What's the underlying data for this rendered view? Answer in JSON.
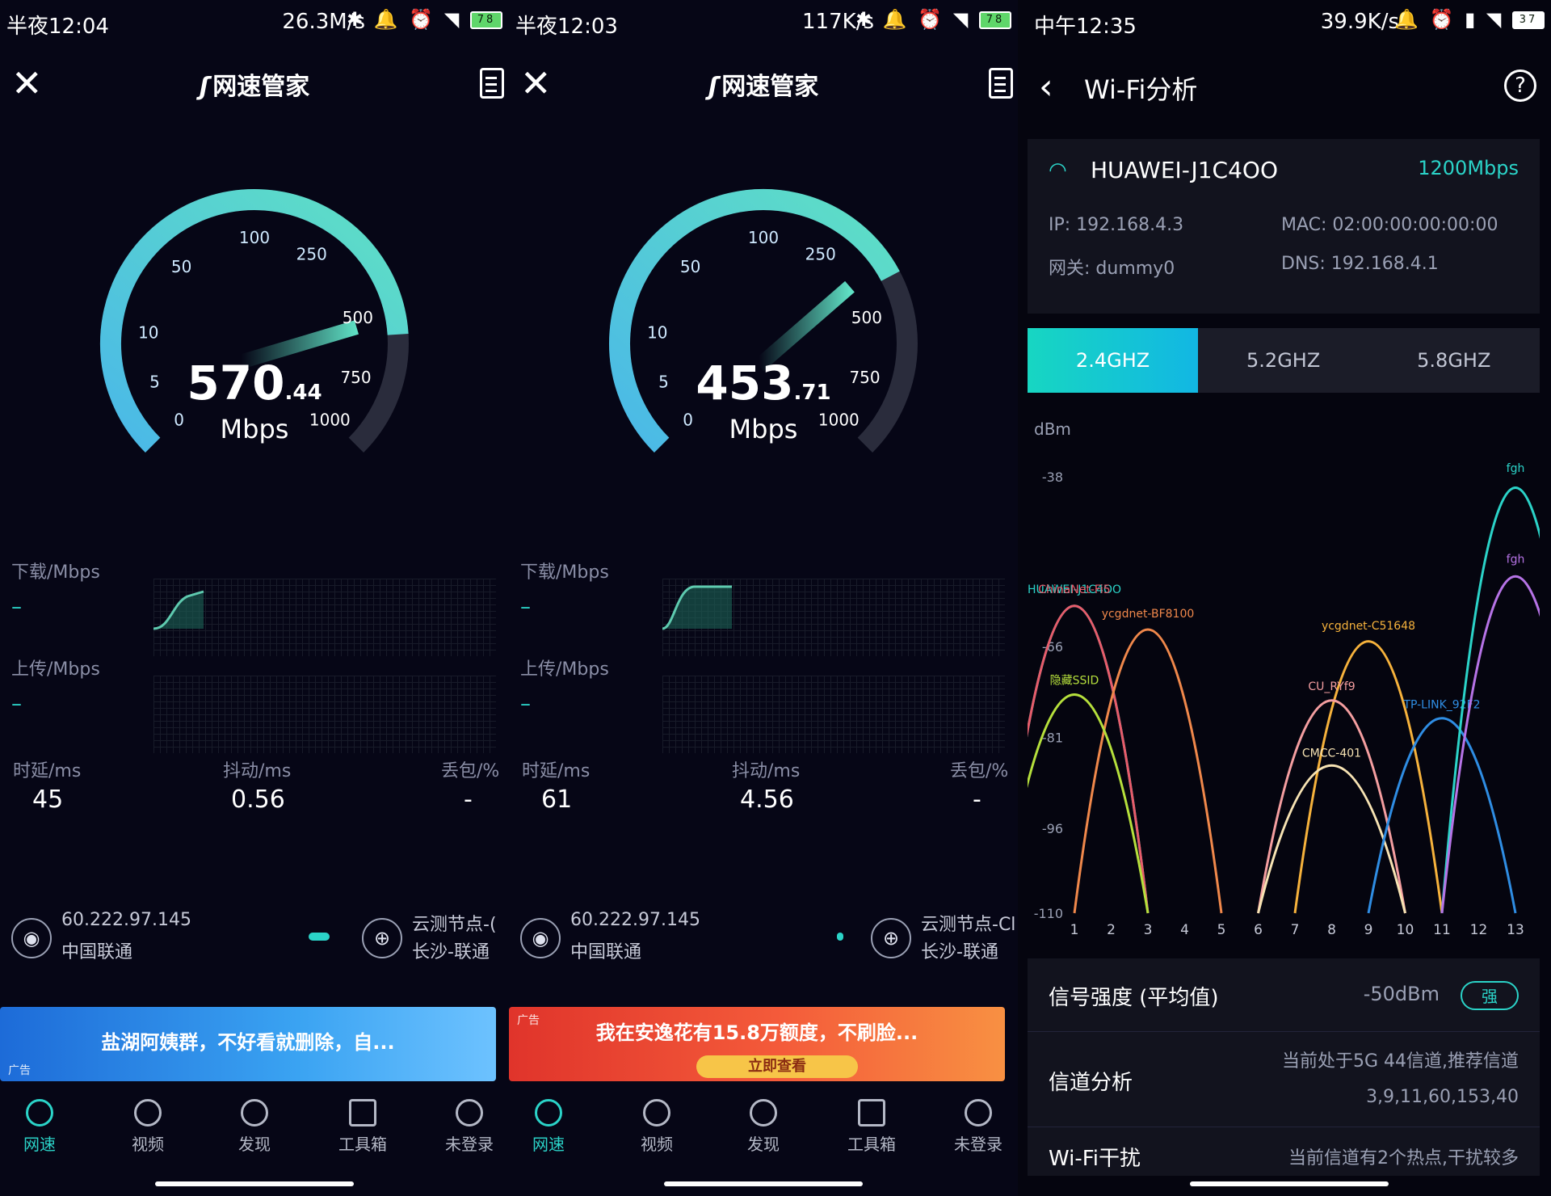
{
  "colors": {
    "accent": "#2bd3c8",
    "bg": "#060616"
  },
  "panels": [
    {
      "status": {
        "time": "半夜12:04",
        "speed": "26.3M/s",
        "battery": "78"
      },
      "brand": "网速管家",
      "gauge": {
        "ticks": [
          "0",
          "5",
          "10",
          "50",
          "100",
          "250",
          "500",
          "750",
          "1000"
        ],
        "value_fraction": 0.82
      },
      "reading": {
        "main": "570",
        "decimal": ".44",
        "unit": "Mbps"
      },
      "download_label": "下载/Mbps",
      "download_value": "–",
      "upload_label": "上传/Mbps",
      "upload_value": "–",
      "latency_label": "时延/ms",
      "latency": "45",
      "jitter_label": "抖动/ms",
      "jitter": "0.56",
      "loss_label": "丢包/%",
      "loss": "-",
      "ip": "60.222.97.145",
      "isp": "中国联通",
      "node": "云测节点-(",
      "node_isp": "长沙-联通",
      "ad": {
        "text": "盐湖阿姨群，不好看就删除，自...",
        "tag": "广告"
      }
    },
    {
      "status": {
        "time": "半夜12:03",
        "speed": "117K/s",
        "battery": "78"
      },
      "brand": "网速管家",
      "gauge": {
        "ticks": [
          "0",
          "5",
          "10",
          "50",
          "100",
          "250",
          "500",
          "750",
          "1000"
        ],
        "value_fraction": 0.73
      },
      "reading": {
        "main": "453",
        "decimal": ".71",
        "unit": "Mbps"
      },
      "download_label": "下载/Mbps",
      "download_value": "–",
      "upload_label": "上传/Mbps",
      "upload_value": "–",
      "latency_label": "时延/ms",
      "latency": "61",
      "jitter_label": "抖动/ms",
      "jitter": "4.56",
      "loss_label": "丢包/%",
      "loss": "-",
      "ip": "60.222.97.145",
      "isp": "中国联通",
      "node": "云测节点-Cl",
      "node_isp": "长沙-联通",
      "ad": {
        "text": "我在安逸花有15.8万额度，不刷脸...",
        "tag": "广告",
        "button": "立即查看"
      }
    }
  ],
  "tabs": [
    "网速",
    "视频",
    "发现",
    "工具箱",
    "未登录"
  ],
  "wifi": {
    "status": {
      "time": "中午12:35",
      "speed": "39.9K/s",
      "battery": "37"
    },
    "title": "Wi-Fi分析",
    "ssid": "HUAWEI-J1C4OO",
    "rate": "1200Mbps",
    "ip": "IP: 192.168.4.3",
    "mac": "MAC: 02:00:00:00:00:00",
    "gateway": "网关: dummy0",
    "dns": "DNS: 192.168.4.1",
    "bands": [
      "2.4GHZ",
      "5.2GHZ",
      "5.8GHZ"
    ],
    "signal_label": "信号强度 (平均值)",
    "signal_value": "-50dBm",
    "signal_badge": "强",
    "channel_label": "信道分析",
    "channel_value_1": "当前处于5G 44信道,推荐信道",
    "channel_value_2": "3,9,11,60,153,40",
    "interf_label": "Wi-Fi干扰",
    "interf_value": "当前信道有2个热点,干扰较多"
  },
  "chart_data": {
    "type": "area",
    "ylabel": "dBm",
    "yticks": [
      -38,
      -66,
      -81,
      -96,
      -110
    ],
    "xticks": [
      1,
      2,
      3,
      4,
      5,
      6,
      7,
      8,
      9,
      10,
      11,
      12,
      13
    ],
    "ylim": [
      -110,
      -30
    ],
    "series": [
      {
        "name": "HUAWEI-J1C4OO",
        "channel": 1,
        "peak": -58,
        "color": "#2bd3c8"
      },
      {
        "name": "ChinaNet-Fi5",
        "channel": 1,
        "peak": -58,
        "color": "#e85b6a"
      },
      {
        "name": "ycgdnet-BF8100",
        "channel": 3,
        "peak": -62,
        "color": "#f0884b"
      },
      {
        "name": "隐藏SSID",
        "channel": 1,
        "peak": -73,
        "color": "#b6e03c"
      },
      {
        "name": "ycgdnet-C51648",
        "channel": 9,
        "peak": -64,
        "color": "#f6b23c"
      },
      {
        "name": "CU_RYf9",
        "channel": 8,
        "peak": -74,
        "color": "#f49ea0"
      },
      {
        "name": "CMCC-401",
        "channel": 8,
        "peak": -85,
        "color": "#f7e3b3"
      },
      {
        "name": "TP-LINK_92F2",
        "channel": 11,
        "peak": -77,
        "color": "#2f8de3"
      },
      {
        "name": "fgh",
        "channel": 13,
        "peak": -38,
        "color": "#2bd3c8"
      },
      {
        "name": "fgh",
        "channel": 13,
        "peak": -53,
        "color": "#b673e6"
      }
    ]
  }
}
